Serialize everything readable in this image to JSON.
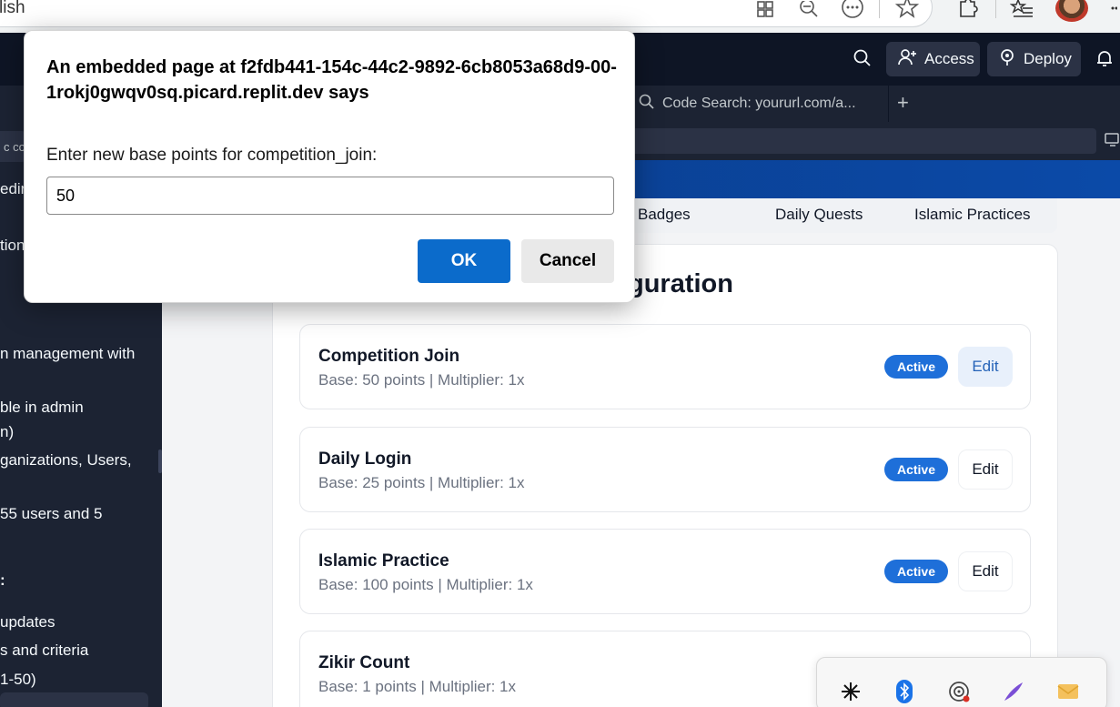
{
  "browser": {
    "address_text": "lish",
    "icons": [
      "grid-icon",
      "zoom-out-icon",
      "more-icon",
      "star-icon",
      "extensions-icon",
      "favorites-icon",
      "profile-avatar"
    ]
  },
  "replit": {
    "access_label": "Access",
    "deploy_label": "Deploy",
    "tab_label": "Code Search: yoururl.com/a...",
    "chip_text": "c co"
  },
  "left_panel": {
    "lines": [
      "edire",
      "tion",
      "n management with",
      "ble in admin",
      "n)",
      "ganizations, Users,",
      "55 users and 5",
      ":",
      "updates",
      "s and criteria",
      "1-50)"
    ]
  },
  "app": {
    "tabs": [
      "Badges",
      "Daily Quests",
      "Islamic Practices"
    ],
    "title": "guration",
    "rows": [
      {
        "name": "Competition Join",
        "meta": "Base: 50 points | Multiplier: 1x",
        "status": "Active",
        "edit": "Edit"
      },
      {
        "name": "Daily Login",
        "meta": "Base: 25 points | Multiplier: 1x",
        "status": "Active",
        "edit": "Edit"
      },
      {
        "name": "Islamic Practice",
        "meta": "Base: 100 points | Multiplier: 1x",
        "status": "Active",
        "edit": "Edit"
      },
      {
        "name": "Zikir Count",
        "meta": "Base: 1 points | Multiplier: 1x"
      }
    ]
  },
  "dialog": {
    "title": "An embedded page at f2fdb441-154c-44c2-9892-6cb8053a68d9-00-1rokj0gwqv0sq.picard.replit.dev says",
    "message": "Enter new base points for competition_join:",
    "input_value": "50",
    "ok_label": "OK",
    "cancel_label": "Cancel"
  },
  "tray": {
    "icons": [
      "app-star-icon",
      "bluetooth-icon",
      "hotspot-icon",
      "pen-icon",
      "mail-icon"
    ]
  },
  "colors": {
    "accent": "#0b6bcb",
    "badge": "#1e6fd9",
    "dark_bg": "#1c2333",
    "header_bg": "#0e1525"
  }
}
